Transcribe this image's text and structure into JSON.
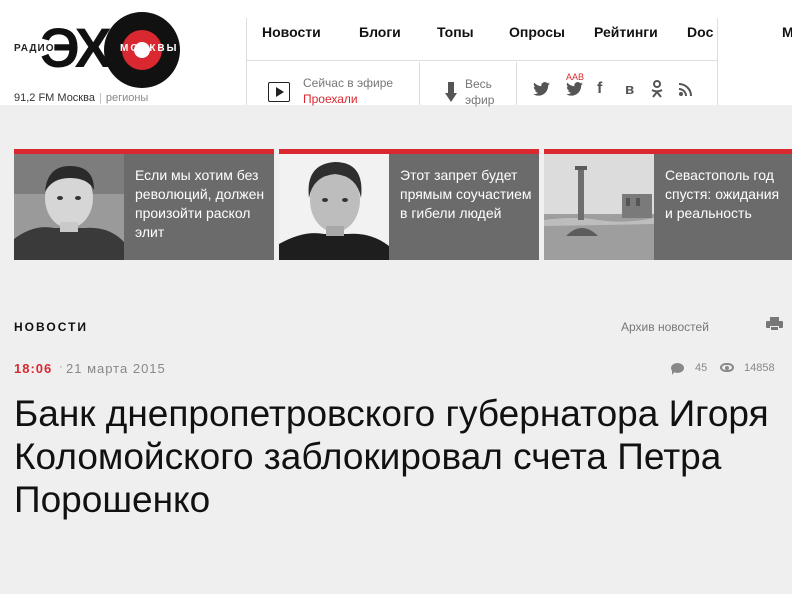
{
  "logo": {
    "radio": "РАДИО",
    "moskvy": "МОСКВЫ"
  },
  "station": {
    "frequency": "91,2 FM Москва",
    "separator": "|",
    "regions": "регионы"
  },
  "nav": [
    {
      "label": "Новости"
    },
    {
      "label": "Блоги"
    },
    {
      "label": "Топы"
    },
    {
      "label": "Опросы"
    },
    {
      "label": "Рейтинги"
    },
    {
      "label": "Doc"
    }
  ],
  "menu_truncated": "М",
  "onair": {
    "label": "Сейчас в эфире",
    "show": "Проехали"
  },
  "allair": {
    "label_line1": "Весь",
    "label_line2": "эфир"
  },
  "social": {
    "aab": "AAB",
    "icons": [
      "twitter-icon",
      "twitter-aab-icon",
      "facebook-icon",
      "vk-icon",
      "odnoklassniki-icon",
      "rss-icon"
    ]
  },
  "featured": [
    {
      "text": "Если мы хотим без революций, должен произойти раскол элит"
    },
    {
      "text": "Этот запрет будет прямым соучастием в гибели людей"
    },
    {
      "text": "Севастополь год спустя: ожидания и реальность"
    }
  ],
  "section": {
    "title": "НОВОСТИ",
    "archive": "Архив новостей"
  },
  "article": {
    "time": "18:06",
    "date_separator": "·",
    "date": "21 марта 2015",
    "comments": "45",
    "views": "14858",
    "headline": "Банк днепропетровского губернатора Игоря Коломойского заблокировал счета Петра Порошенко"
  },
  "colors": {
    "accent": "#d9282f",
    "card_bg": "#6b6b6b",
    "page_bg": "#efefef"
  }
}
